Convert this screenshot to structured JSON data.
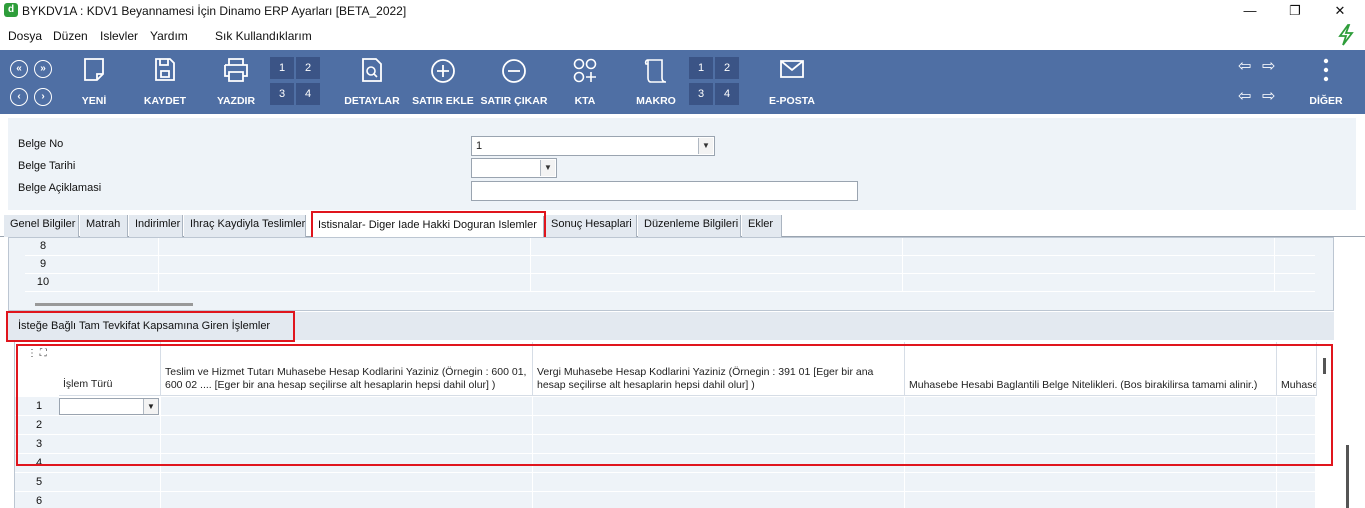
{
  "window": {
    "title": "BYKDV1A : KDV1 Beyannamesi İçin Dinamo ERP Ayarları [BETA_2022]",
    "app_icon_letter": "d",
    "minimize": "—",
    "maximize": "❐",
    "close": "✕"
  },
  "menu": [
    "Dosya",
    "Düzen",
    "Islevler",
    "Yardım",
    "Sık Kullandıklarım"
  ],
  "toolbar": {
    "yeni": "YENİ",
    "kaydet": "KAYDET",
    "yazdir": "YAZDIR",
    "detaylar": "DETAYLAR",
    "satir_ekle": "SATIR EKLE",
    "satir_cikar": "SATIR ÇIKAR",
    "kta": "KTA",
    "makro": "MAKRO",
    "eposta": "E-POSTA",
    "diger": "DİĞER",
    "grid1": [
      "1",
      "2",
      "3",
      "4"
    ],
    "grid2": [
      "1",
      "2",
      "3",
      "4"
    ]
  },
  "form": {
    "belge_no_label": "Belge No",
    "belge_no_value": "1",
    "belge_tarihi_label": "Belge Tarihi",
    "belge_tarihi_value": "",
    "belge_aciklamasi_label": "Belge Açiklamasi",
    "belge_aciklamasi_value": ""
  },
  "tabs": [
    "Genel Bilgiler",
    "Matrah",
    "Indirimler",
    "Ihraç Kaydiyla Teslimler",
    "Istisnalar- Diger Iade Hakki Doguran Islemler",
    "Sonuç Hesaplari",
    "Düzenleme Bilgileri",
    "Ekler"
  ],
  "grid1_rows": [
    "8",
    "9",
    "10"
  ],
  "section_title": "İsteğe Bağlı Tam Tevkifat Kapsamına Giren İşlemler",
  "grid2": {
    "headers": [
      "İşlem Türü",
      "Teslim ve Hizmet Tutarı Muhasebe Hesap Kodlarini Yaziniz (Örnegin : 600 01, 600 02 ....  [Eger bir ana hesap seçilirse alt hesaplarin hepsi dahil olur] )",
      "Vergi Muhasebe Hesap Kodlarini Yaziniz (Örnegin : 391 01  [Eger bir ana hesap seçilirse alt hesaplarin hepsi dahil olur] )",
      "Muhasebe Hesabi Baglantili Belge Nitelikleri. (Bos birakilirsa tamami alinir.)",
      "Muhase"
    ],
    "rows": [
      "1",
      "2",
      "3",
      "4",
      "5",
      "6"
    ]
  },
  "colors": {
    "toolbar_bg": "#4f6fa4",
    "highlight": "#e0151d"
  }
}
